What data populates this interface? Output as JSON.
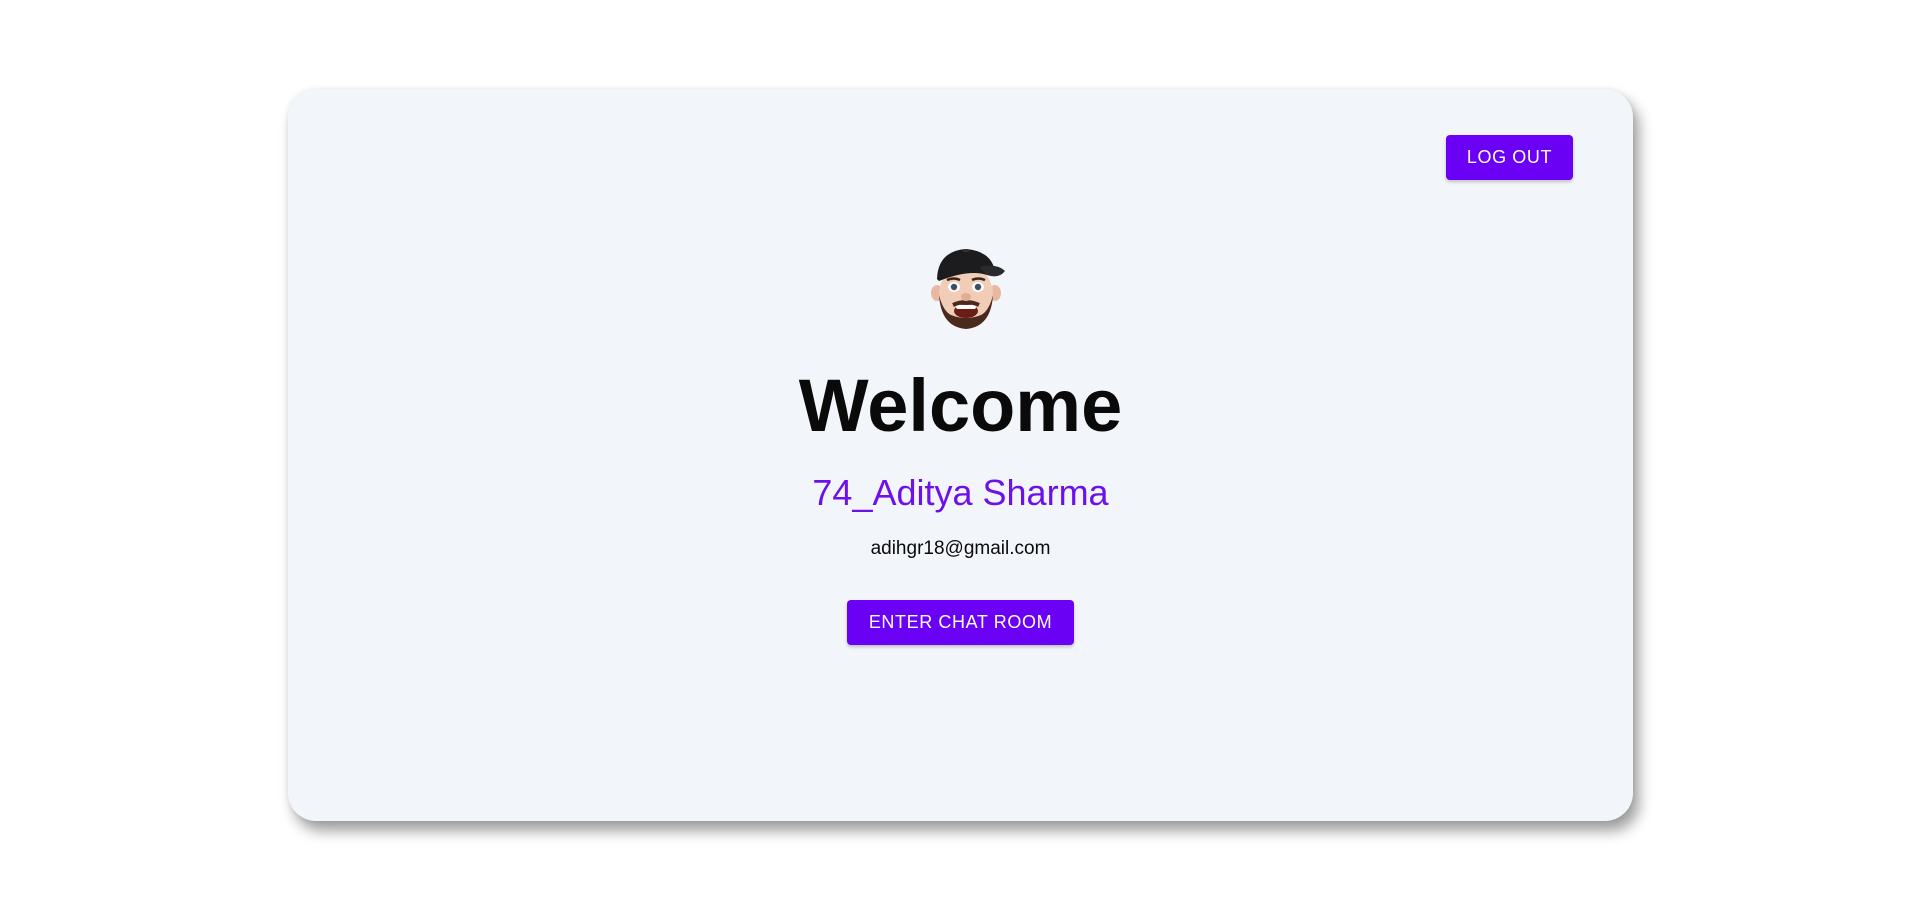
{
  "header": {
    "logout_label": "LOG OUT"
  },
  "profile": {
    "avatar": "memoji-avatar-cap-beard",
    "greeting": "Welcome",
    "username": "74_Aditya Sharma",
    "email": "adihgr18@gmail.com"
  },
  "actions": {
    "enter_label": "ENTER CHAT ROOM"
  },
  "colors": {
    "accent": "#6a00f4",
    "username": "#6d11ea",
    "card_background": "#f2f5fa"
  }
}
